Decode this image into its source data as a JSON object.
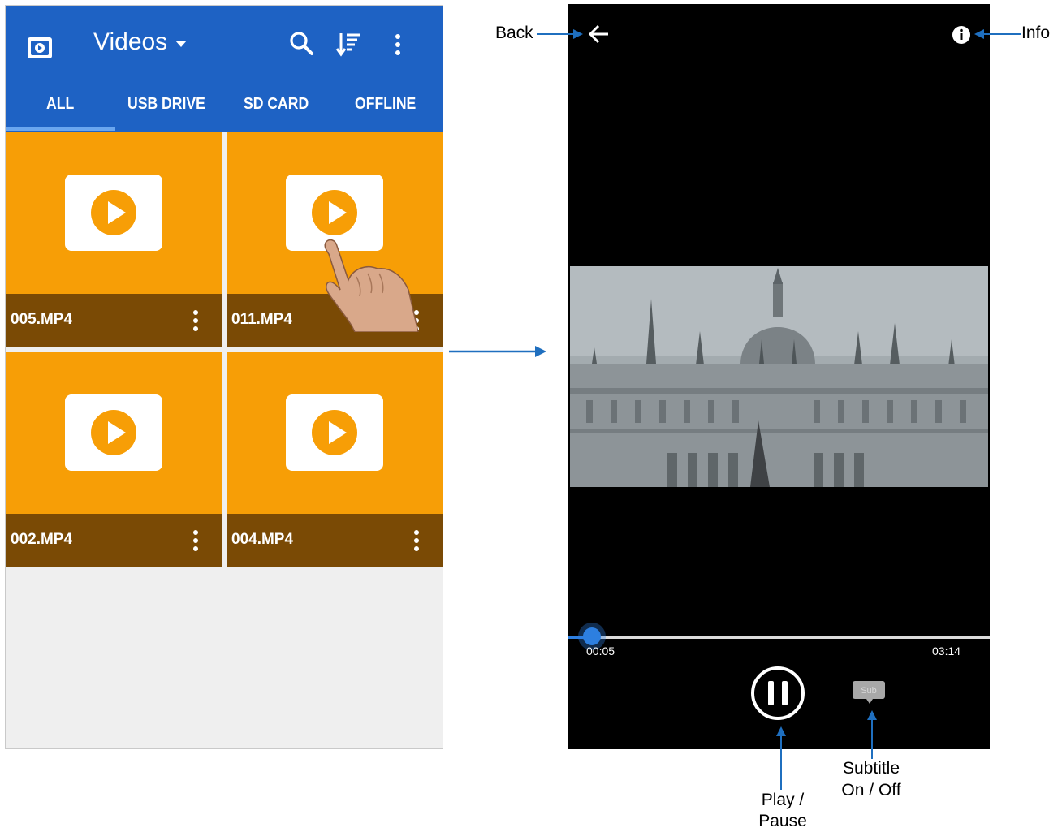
{
  "app_bar": {
    "title": "Videos",
    "icons": [
      "video-app-icon",
      "search-icon",
      "sort-icon",
      "more-vert-icon"
    ]
  },
  "tabs": [
    {
      "label": "ALL",
      "selected": true
    },
    {
      "label": "USB DRIVE",
      "selected": false
    },
    {
      "label": "SD CARD",
      "selected": false
    },
    {
      "label": "OFFLINE",
      "selected": false
    }
  ],
  "videos": [
    {
      "name": "005.MP4"
    },
    {
      "name": "011.MP4"
    },
    {
      "name": "002.MP4"
    },
    {
      "name": "004.MP4"
    }
  ],
  "player": {
    "time_current": "00:05",
    "time_total": "03:14",
    "progress_fraction": 0.026,
    "subtitle_label": "Sub"
  },
  "callouts": {
    "back": "Back",
    "info": "Info",
    "play_pause_line1": "Play /",
    "play_pause_line2": "Pause",
    "subtitle_line1": "Subtitle",
    "subtitle_line2": "On / Off"
  },
  "colors": {
    "app_bar": "#1e62c4",
    "tile": "#f79e06",
    "tile_bar": "#7a4a05",
    "accent": "#2d7fe0",
    "callout_line": "#1f6fbf"
  }
}
